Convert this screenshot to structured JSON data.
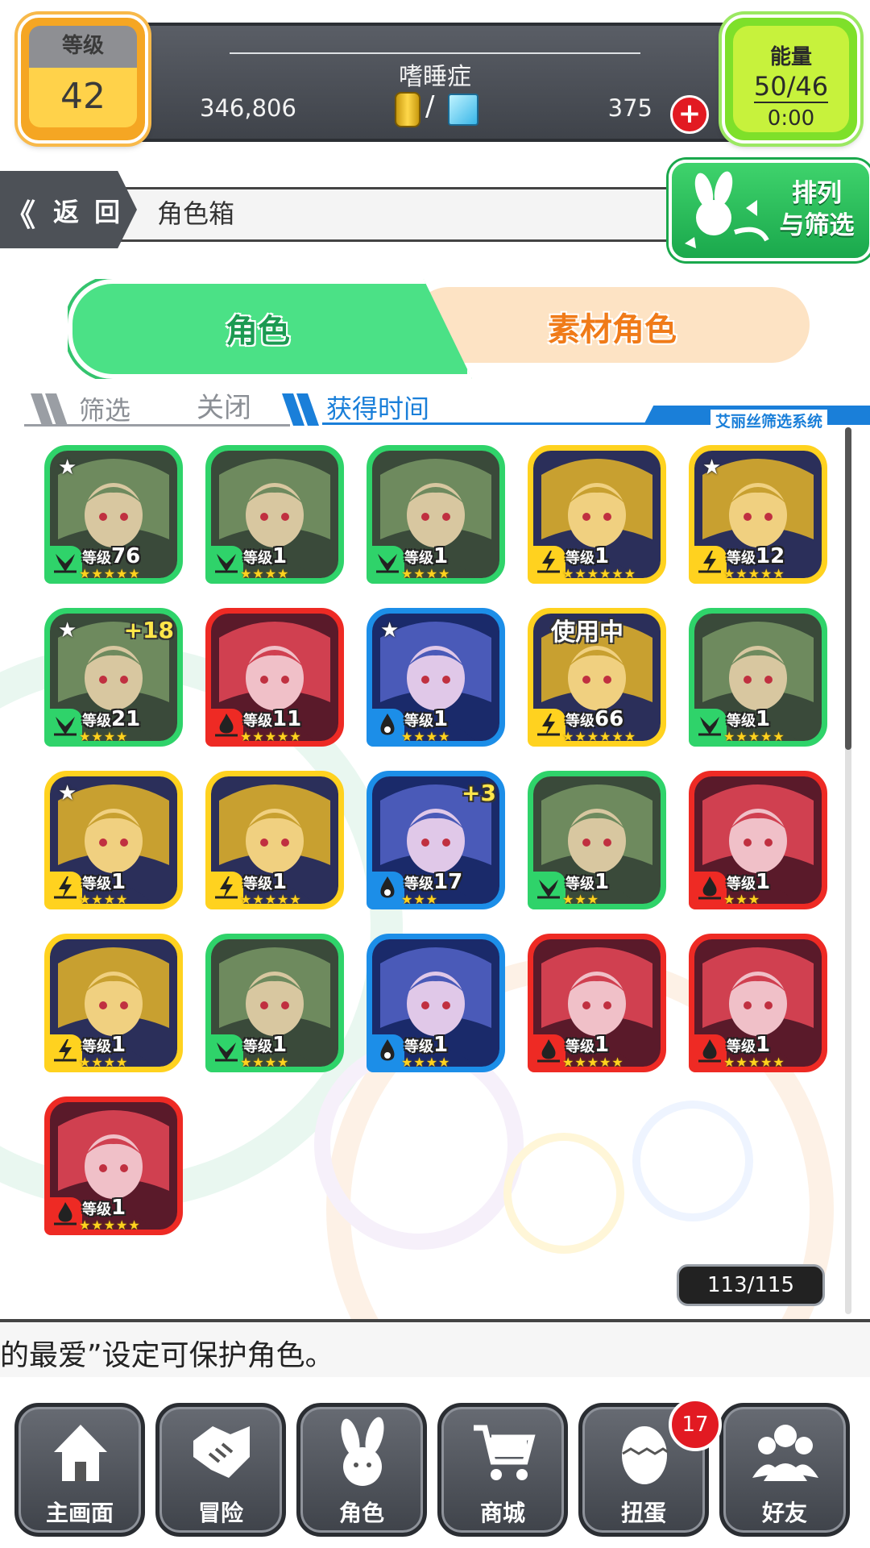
{
  "header": {
    "level_label": "等级",
    "level_value": "42",
    "player_name": "嗜睡症",
    "gold": "346,806",
    "separator": "/",
    "gems": "375",
    "energy_label": "能量",
    "energy_value": "50/46",
    "energy_timer": "0:00"
  },
  "nav": {
    "back_label": "返 回",
    "page_title": "角色箱",
    "sort_label_1": "排列",
    "sort_label_2": "与筛选"
  },
  "tabs": {
    "character": "角色",
    "material": "素材角色"
  },
  "filter": {
    "label": "筛选",
    "value": "关闭",
    "sort_order": "获得时间",
    "system": "艾丽丝筛选系统"
  },
  "level_prefix": "等级",
  "cards": [
    {
      "level": "76",
      "element": "wind",
      "frame": "green",
      "stars": 5,
      "favorite": true
    },
    {
      "level": "1",
      "element": "wind",
      "frame": "green",
      "stars": 4
    },
    {
      "level": "1",
      "element": "wind",
      "frame": "green",
      "stars": 4
    },
    {
      "level": "1",
      "element": "thunder",
      "frame": "yellow",
      "stars": 6
    },
    {
      "level": "12",
      "element": "thunder",
      "frame": "yellow",
      "stars": 5,
      "favorite": true
    },
    {
      "level": "21",
      "element": "wind",
      "frame": "green",
      "stars": 4,
      "favorite": true,
      "plus": "+18"
    },
    {
      "level": "11",
      "element": "fire",
      "frame": "red",
      "stars": 5
    },
    {
      "level": "1",
      "element": "water",
      "frame": "blue",
      "stars": 4,
      "favorite": true
    },
    {
      "level": "66",
      "element": "thunder",
      "frame": "yellow",
      "stars": 6,
      "tag": "使用中"
    },
    {
      "level": "1",
      "element": "wind",
      "frame": "green",
      "stars": 5
    },
    {
      "level": "1",
      "element": "thunder",
      "frame": "yellow",
      "stars": 4,
      "favorite": true
    },
    {
      "level": "1",
      "element": "thunder",
      "frame": "yellow",
      "stars": 5
    },
    {
      "level": "17",
      "element": "water",
      "frame": "blue",
      "stars": 3,
      "plus": "+3"
    },
    {
      "level": "1",
      "element": "wind",
      "frame": "green",
      "stars": 3
    },
    {
      "level": "1",
      "element": "fire",
      "frame": "red",
      "stars": 3
    },
    {
      "level": "1",
      "element": "thunder",
      "frame": "yellow",
      "stars": 4
    },
    {
      "level": "1",
      "element": "wind",
      "frame": "green",
      "stars": 4
    },
    {
      "level": "1",
      "element": "water",
      "frame": "blue",
      "stars": 4
    },
    {
      "level": "1",
      "element": "fire",
      "frame": "red",
      "stars": 5
    },
    {
      "level": "1",
      "element": "fire",
      "frame": "red",
      "stars": 5
    },
    {
      "level": "1",
      "element": "fire",
      "frame": "red",
      "stars": 5
    }
  ],
  "box_count": "113/115",
  "tip": "的最爱”设定可保护角色。",
  "bottom_nav": [
    {
      "label": "主画面",
      "icon": "home-icon"
    },
    {
      "label": "冒险",
      "icon": "handshake-icon"
    },
    {
      "label": "角色",
      "icon": "bunny-icon"
    },
    {
      "label": "商城",
      "icon": "cart-icon"
    },
    {
      "label": "扭蛋",
      "icon": "egg-icon"
    },
    {
      "label": "好友",
      "icon": "friends-icon"
    }
  ],
  "gacha_badge": "17",
  "colors": {
    "green": "#2fd36a",
    "yellow": "#ffd21f",
    "red": "#ee2a24",
    "blue": "#1c8ee8",
    "accent_blue": "#1a7fd9",
    "accent_orange": "#f07b19"
  }
}
